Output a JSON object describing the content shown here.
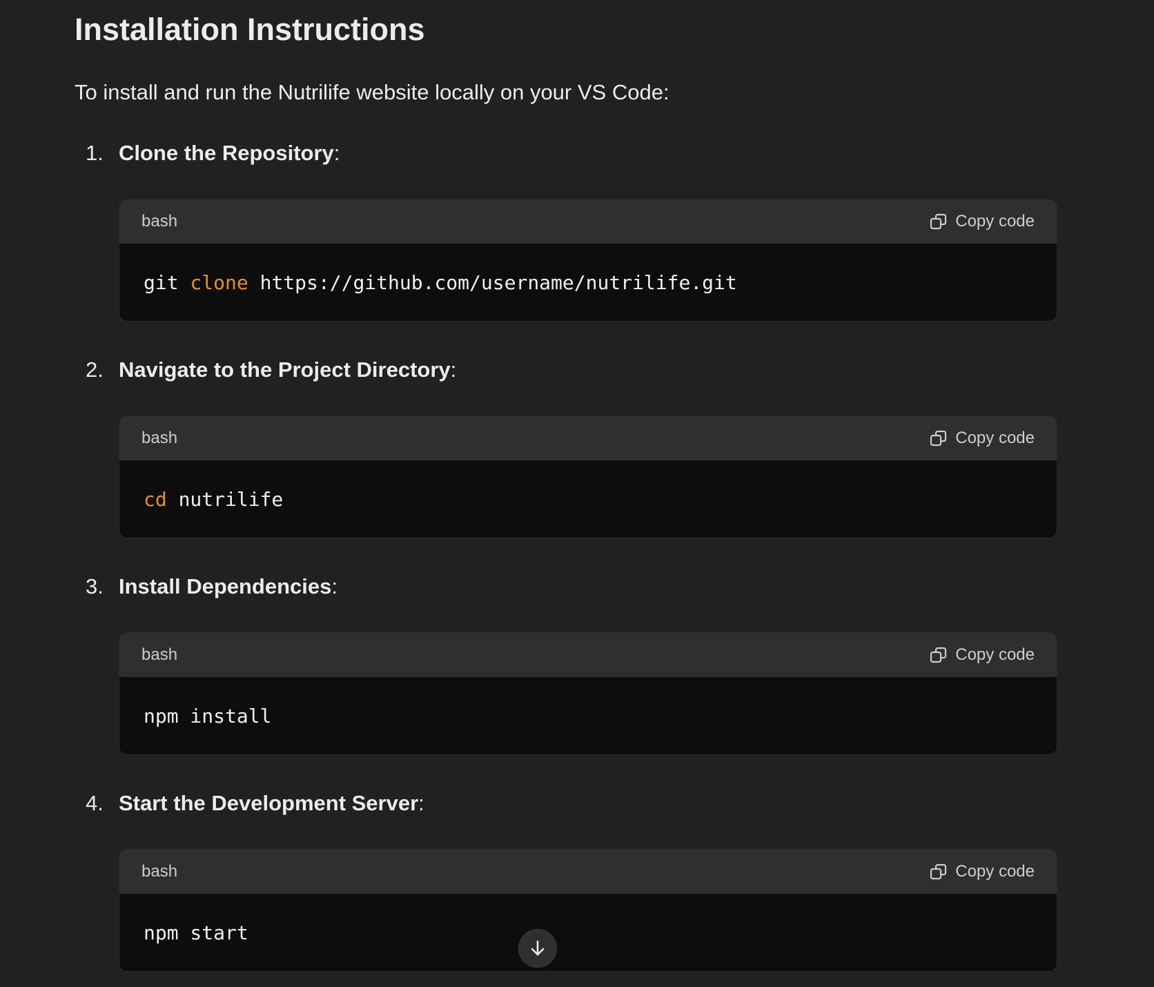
{
  "page": {
    "title": "Installation Instructions",
    "intro": "To install and run the Nutrilife website locally on your VS Code:"
  },
  "steps": [
    {
      "number": "1.",
      "title": "Clone the Repository",
      "colon": ":",
      "code": {
        "language": "bash",
        "copy_label": "Copy code",
        "tokens": [
          {
            "text": "git ",
            "kind": "plain"
          },
          {
            "text": "clone",
            "kind": "keyword"
          },
          {
            "text": " https://github.com/username/nutrilife.git",
            "kind": "plain"
          }
        ]
      }
    },
    {
      "number": "2.",
      "title": "Navigate to the Project Directory",
      "colon": ":",
      "code": {
        "language": "bash",
        "copy_label": "Copy code",
        "tokens": [
          {
            "text": "cd",
            "kind": "keyword"
          },
          {
            "text": " nutrilife",
            "kind": "plain"
          }
        ]
      }
    },
    {
      "number": "3.",
      "title": "Install Dependencies",
      "colon": ":",
      "code": {
        "language": "bash",
        "copy_label": "Copy code",
        "tokens": [
          {
            "text": "npm install",
            "kind": "plain"
          }
        ]
      }
    },
    {
      "number": "4.",
      "title": "Start the Development Server",
      "colon": ":",
      "code": {
        "language": "bash",
        "copy_label": "Copy code",
        "tokens": [
          {
            "text": "npm start",
            "kind": "plain"
          }
        ]
      }
    }
  ],
  "icons": {
    "copy": "copy-icon",
    "scroll_down": "arrow-down-icon"
  },
  "colors": {
    "background": "#212121",
    "code_header": "#2f2f2f",
    "code_body": "#0d0d0d",
    "keyword": "#e9950c",
    "text": "#ececec"
  }
}
